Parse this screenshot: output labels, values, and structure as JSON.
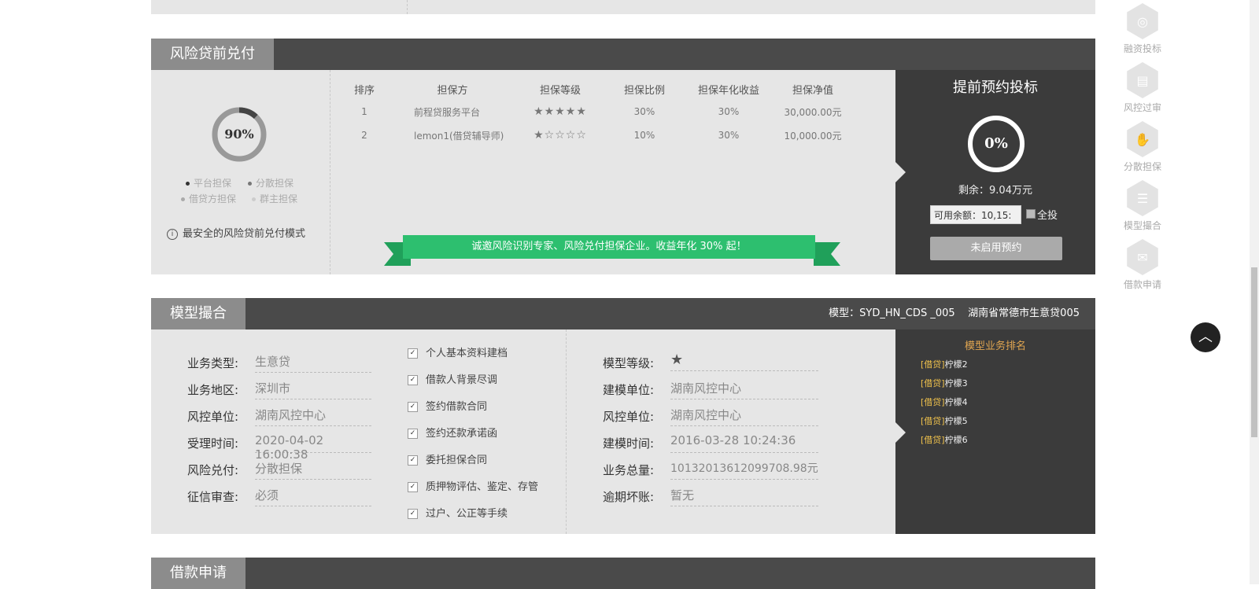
{
  "risk_section": {
    "title": "风险贷前兑付",
    "donut_percent": "90%",
    "donut_fraction": 0.9,
    "legend": [
      "平台担保",
      "分散担保",
      "借贷方担保",
      "群主担保"
    ],
    "note": "最安全的风险贷前兑付模式",
    "table": {
      "headers": [
        "排序",
        "担保方",
        "担保等级",
        "担保比例",
        "担保年化收益",
        "担保净值"
      ],
      "rows": [
        {
          "rank": "1",
          "name": "前程贷服务平台",
          "stars": "★★★★★",
          "ratio": "30%",
          "yield": "30%",
          "net": "30,000.00元"
        },
        {
          "rank": "2",
          "name": "lemon1(借贷辅导师)",
          "stars": "★☆☆☆☆",
          "ratio": "10%",
          "yield": "30%",
          "net": "10,000.00元"
        }
      ]
    },
    "banner": "诚邀风险识别专家、风险兑付担保企业。收益年化 30% 起！",
    "invest": {
      "title": "提前预约投标",
      "percent": "0%",
      "remain": "剩余：9.04万元",
      "available": "可用余额：10,15:",
      "all_label": "全投",
      "button": "未启用预约"
    }
  },
  "model_section": {
    "title": "模型撮合",
    "model_info": "模型：SYD_HN_CDS _005    湖南省常德市生意贷005",
    "left_fields": [
      {
        "label": "业务类型:",
        "value": "生意贷"
      },
      {
        "label": "业务地区:",
        "value": "深圳市"
      },
      {
        "label": "风控单位:",
        "value": "湖南风控中心"
      },
      {
        "label": "受理时间:",
        "value": "2020-04-02 16:00:38"
      },
      {
        "label": "风险兑付:",
        "value": "分散担保"
      },
      {
        "label": "征信审查:",
        "value": "必须"
      }
    ],
    "checklist": [
      "个人基本资料建档",
      "借款人背景尽调",
      "签约借款合同",
      "签约还款承诺函",
      "委托担保合同",
      "质押物评估、鉴定、存管",
      "过户、公正等手续"
    ],
    "right_fields": [
      {
        "label": "模型等级:",
        "value": "★"
      },
      {
        "label": "建模单位:",
        "value": "湖南风控中心"
      },
      {
        "label": "风控单位:",
        "value": "湖南风控中心"
      },
      {
        "label": "建模时间:",
        "value": "2016-03-28 10:24:36"
      },
      {
        "label": "业务总量:",
        "value": "10132013612099708.98元"
      },
      {
        "label": "逾期坏账:",
        "value": "暂无"
      }
    ],
    "ranking": {
      "title": "模型业务排名",
      "items": [
        {
          "tag": "[借贷]",
          "name": "柠檬2"
        },
        {
          "tag": "[借贷]",
          "name": "柠檬3"
        },
        {
          "tag": "[借贷]",
          "name": "柠檬4"
        },
        {
          "tag": "[借贷]",
          "name": "柠檬5"
        },
        {
          "tag": "[借贷]",
          "name": "柠檬6"
        }
      ]
    }
  },
  "loan_section": {
    "title": "借款申请"
  },
  "sidebar": [
    {
      "label": "融资投标",
      "icon": "target-icon"
    },
    {
      "label": "风控过审",
      "icon": "document-check-icon"
    },
    {
      "label": "分散担保",
      "icon": "hand-icon"
    },
    {
      "label": "模型撮合",
      "icon": "database-icon"
    },
    {
      "label": "借款申请",
      "icon": "envelope-icon"
    }
  ],
  "colors": {
    "dark": "#3b3b3b",
    "header": "#4a4a4a",
    "tab": "#8c8c8c",
    "green": "#2dbf6f",
    "gold": "#f0c24c"
  }
}
